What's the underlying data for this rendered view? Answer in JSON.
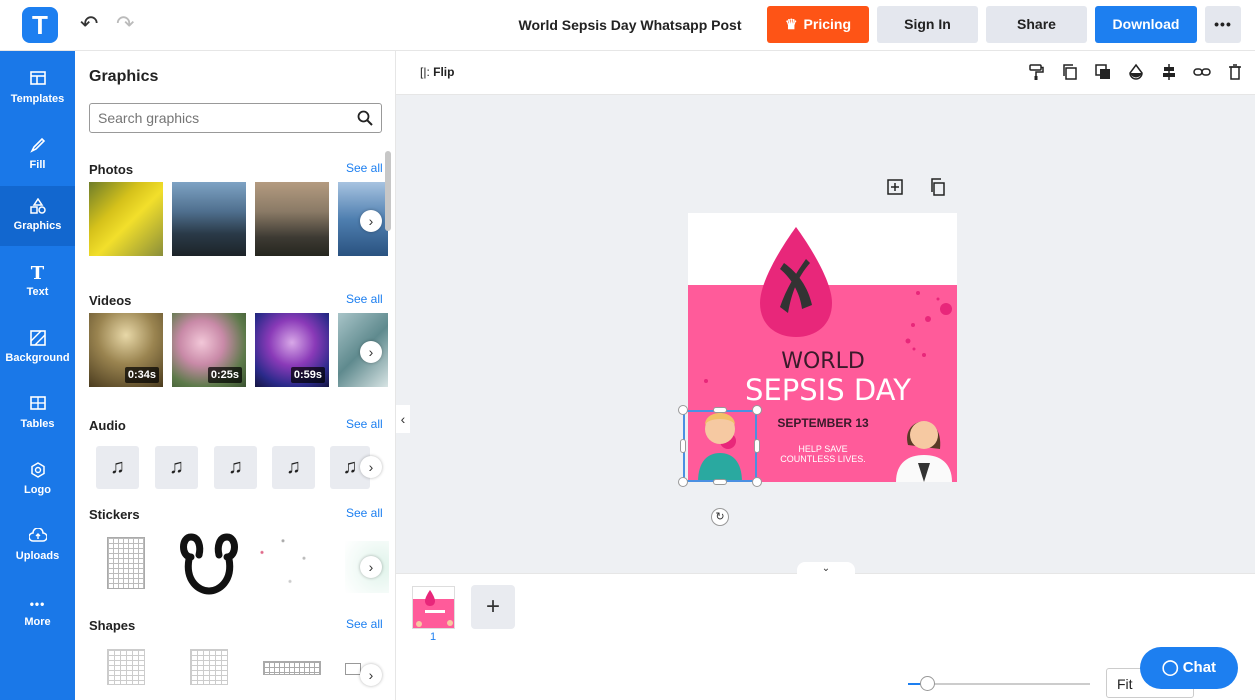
{
  "app": {
    "logo_letter": "T",
    "doc_title": "World Sepsis Day Whatsapp Post",
    "buttons": {
      "pricing": "Pricing",
      "sign_in": "Sign In",
      "share": "Share",
      "download": "Download",
      "more": "•••"
    },
    "colors": {
      "accent": "#1d7ff0",
      "pricing": "#fe5416",
      "rail": "#1a78e8",
      "design_pink": "#ff5b9a"
    }
  },
  "rail": [
    {
      "label": "Templates",
      "icon": "templates-icon"
    },
    {
      "label": "Fill",
      "icon": "fill-icon"
    },
    {
      "label": "Graphics",
      "icon": "graphics-icon",
      "active": true
    },
    {
      "label": "Text",
      "icon": "text-icon"
    },
    {
      "label": "Background",
      "icon": "background-icon"
    },
    {
      "label": "Tables",
      "icon": "tables-icon"
    },
    {
      "label": "Logo",
      "icon": "logo-icon"
    },
    {
      "label": "Uploads",
      "icon": "uploads-icon"
    },
    {
      "label": "More",
      "icon": "more-icon"
    }
  ],
  "panel": {
    "title": "Graphics",
    "search_placeholder": "Search graphics",
    "sections": {
      "photos": "Photos",
      "videos": "Videos",
      "audio": "Audio",
      "stickers": "Stickers",
      "shapes": "Shapes"
    },
    "see_all": "See all",
    "video_durations": [
      "0:34s",
      "0:25s",
      "0:59s"
    ]
  },
  "toolbar": {
    "flip": "Flip"
  },
  "design": {
    "line1": "WORLD",
    "line2": "SEPSIS DAY",
    "date": "SEPTEMBER 13",
    "tagline1": "HELP SAVE",
    "tagline2": "COUNTLESS LIVES."
  },
  "pages": {
    "current": "1"
  },
  "zoom": {
    "fit_label": "Fit"
  },
  "chat": {
    "label": "Chat"
  }
}
